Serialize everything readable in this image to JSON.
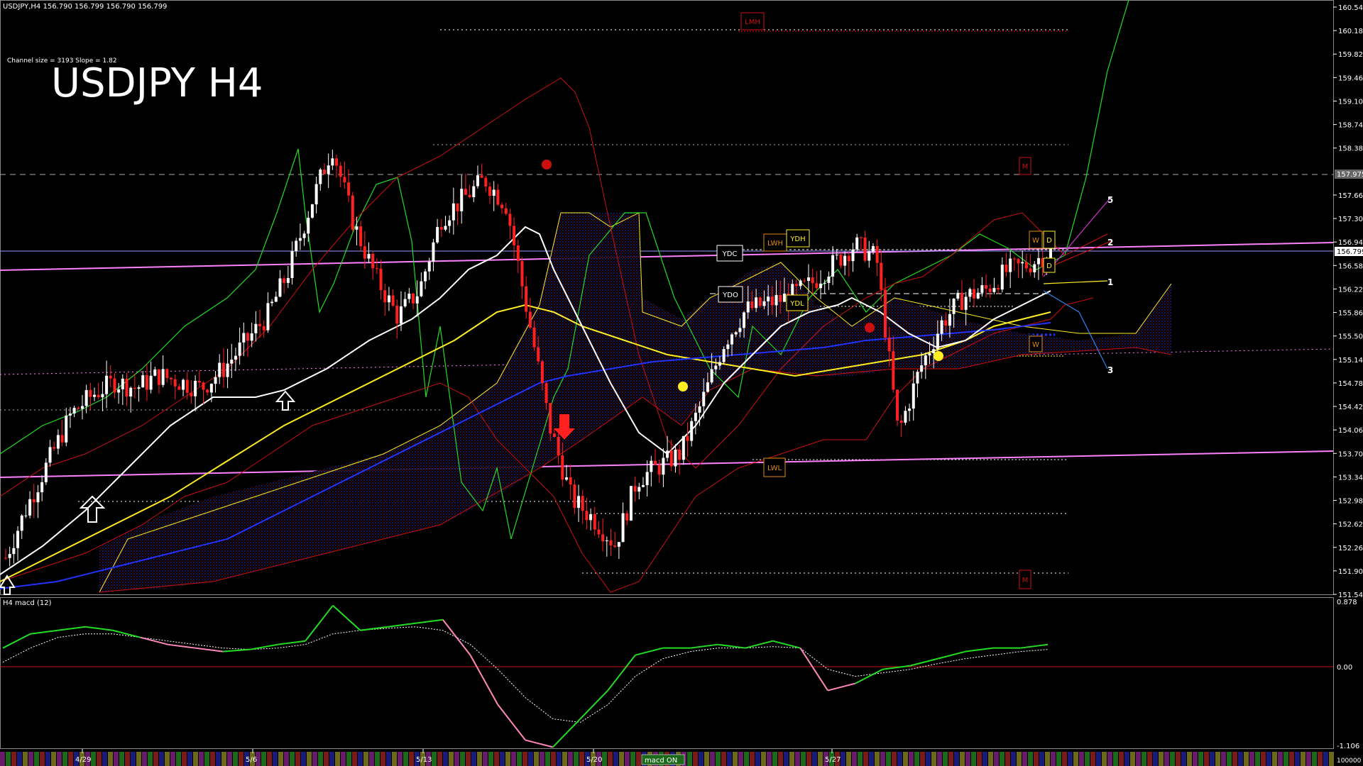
{
  "header": {
    "symbol_info": "USDJPY,H4  156.790 156.799 156.790 156.799",
    "channel_info": "Channel size = 3193 Slope = 1.82",
    "big_title": "USDJPY H4"
  },
  "indicator": {
    "label": "H4  macd (12)",
    "axis_labels": [
      "0.878",
      "0.00",
      "-1.106"
    ],
    "bottom_right_label": "100000"
  },
  "price_axis": {
    "ticks": [
      "160.540",
      "160.180",
      "159.820",
      "159.460",
      "159.100",
      "158.740",
      "158.380",
      "157.660",
      "157.300",
      "156.940",
      "156.580",
      "156.220",
      "155.860",
      "155.500",
      "155.140",
      "154.780",
      "154.420",
      "154.060",
      "153.700",
      "153.340",
      "152.980",
      "152.620",
      "152.260",
      "151.900",
      "151.540"
    ],
    "marker_dashed_label": "157.975",
    "current_price_label": "156.799"
  },
  "time_axis": {
    "labels": [
      "4/29",
      "5/6",
      "5/13",
      "5/20",
      "5/27"
    ],
    "overlay_label": "macd ON"
  },
  "boxes": [
    "LMH",
    "M",
    "YDC",
    "LWH",
    "YDH",
    "YDO",
    "YDL",
    "LWL",
    "W",
    "D",
    "D",
    "W",
    "M"
  ],
  "fibo_numbers": [
    "5",
    "2",
    "1",
    "3"
  ],
  "colors": {
    "background": "#000000",
    "bull": "#ffffff",
    "bear": "#ff2020",
    "kumo": "#1a2a9a",
    "pink": "#ff80ff",
    "yellow": "#ffee22",
    "green": "#22dd22",
    "red_band": "#cc1010",
    "blue_ma": "#2233ff"
  },
  "chart_data": {
    "type": "candlestick",
    "timeframe": "H4",
    "symbol": "USDJPY",
    "x": [
      "4/29",
      "5/6",
      "5/13",
      "5/20",
      "5/27"
    ],
    "close_path": [
      152.1,
      152.9,
      153.6,
      154.3,
      154.6,
      154.8,
      154.7,
      154.9,
      154.8,
      154.7,
      155.0,
      155.4,
      155.8,
      156.5,
      157.5,
      158.4,
      157.2,
      156.4,
      155.8,
      156.2,
      157.3,
      157.6,
      157.9,
      157.5,
      155.8,
      154.1,
      153.0,
      152.7,
      152.3,
      153.3,
      153.5,
      153.7,
      154.5,
      155.4,
      155.9,
      156.0,
      156.1,
      156.3,
      156.6,
      156.9,
      156.7,
      154.0,
      155.0,
      155.7,
      156.1,
      156.2,
      156.5,
      156.6,
      156.8
    ],
    "ylim": [
      151.54,
      160.54
    ],
    "macd": {
      "main": [
        0.3,
        0.5,
        0.55,
        0.6,
        0.55,
        0.45,
        0.35,
        0.3,
        0.25,
        0.28,
        0.35,
        0.4,
        0.9,
        0.55,
        0.6,
        0.65,
        0.7,
        0.2,
        -0.5,
        -1.0,
        -1.1,
        -0.7,
        -0.3,
        0.2,
        0.3,
        0.3,
        0.35,
        0.3,
        0.4,
        0.3,
        -0.3,
        -0.2,
        0.0,
        0.05,
        0.15,
        0.25,
        0.3,
        0.3,
        0.35
      ],
      "signal": [
        0.1,
        0.3,
        0.45,
        0.5,
        0.5,
        0.45,
        0.4,
        0.35,
        0.3,
        0.28,
        0.3,
        0.35,
        0.5,
        0.55,
        0.58,
        0.6,
        0.55,
        0.35,
        0.0,
        -0.4,
        -0.7,
        -0.75,
        -0.5,
        -0.1,
        0.15,
        0.25,
        0.3,
        0.3,
        0.32,
        0.3,
        0.0,
        -0.1,
        -0.05,
        0.0,
        0.08,
        0.15,
        0.2,
        0.25,
        0.28
      ],
      "ylim": [
        -1.106,
        0.878
      ]
    }
  }
}
